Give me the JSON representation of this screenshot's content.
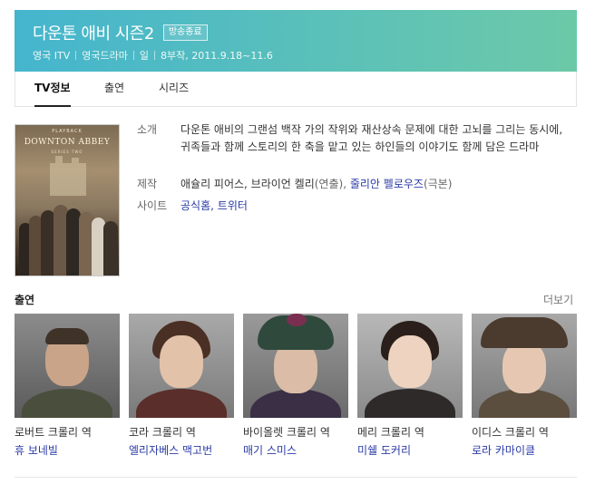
{
  "header": {
    "title": "다운톤 애비 시즌2",
    "badge": "방송종료",
    "meta": [
      "영국 ITV",
      "영국드라마",
      "일",
      "8부작, 2011.9.18~11.6"
    ],
    "colors": {
      "gradient_start": "#45b5ce",
      "gradient_end": "#6cc9a8"
    }
  },
  "tabs": [
    {
      "label": "TV정보",
      "active": true
    },
    {
      "label": "출연",
      "active": false
    },
    {
      "label": "시리즈",
      "active": false
    }
  ],
  "poster": {
    "playback": "PLAYBACK",
    "title": "DOWNTON ABBEY",
    "subtitle": "SERIES TWO"
  },
  "info": {
    "intro_label": "소개",
    "intro_text": "다운톤 애비의 그랜섬 백작 가의 작위와 재산상속 문제에 대한 고뇌를 그리는 동시에, 귀족들과 함께 스토리의 한 축을 맡고 있는 하인들의 이야기도 함께 담은 드라마",
    "production_label": "제작",
    "production_person1": "애슐리 피어스, 브라이언 켈리",
    "production_role1": "(연출),",
    "production_person2": "줄리안 펠로우즈",
    "production_role2": "(극본)",
    "site_label": "사이트",
    "site_official": "공식홈",
    "site_sep": ",",
    "site_twitter": "트위터"
  },
  "cast": {
    "title": "출연",
    "more": "더보기",
    "members": [
      {
        "role": "로버트 크롤리 역",
        "actor": "휴 보네빌"
      },
      {
        "role": "코라 크롤리 역",
        "actor": "엘리자베스 맥고번"
      },
      {
        "role": "바이올렛 크롤리 역",
        "actor": "매기 스미스"
      },
      {
        "role": "메리 크롤리 역",
        "actor": "미쉘 도커리"
      },
      {
        "role": "이디스 크롤리 역",
        "actor": "로라 카마이클"
      }
    ]
  }
}
